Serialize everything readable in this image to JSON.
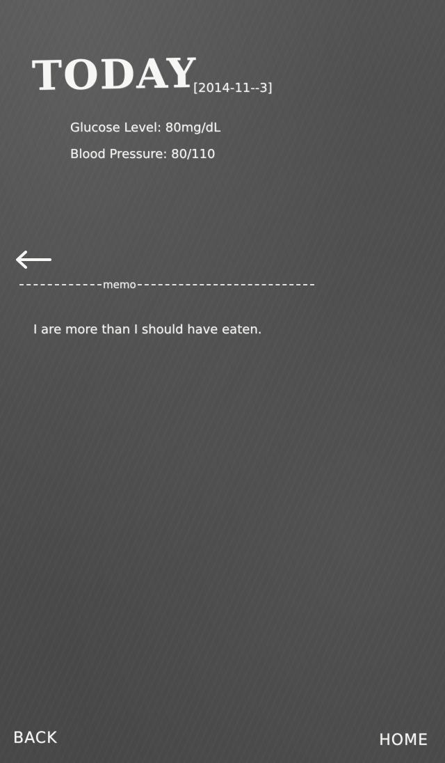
{
  "header": {
    "title": "TODAY",
    "date": "[2014-11--3]"
  },
  "readings": {
    "glucose": "Glucose Level: 80mg/dL",
    "blood_pressure": "Blood Pressure: 80/110"
  },
  "memo": {
    "label": "memo",
    "text": "I are more than I should have eaten."
  },
  "nav": {
    "back_label": "BACK",
    "home_label": "HOME"
  },
  "icons": {
    "back_arrow": "arrow-left-icon"
  },
  "colors": {
    "chalkboard": "#4a4a4a",
    "chalk": "#f4f4f2"
  }
}
